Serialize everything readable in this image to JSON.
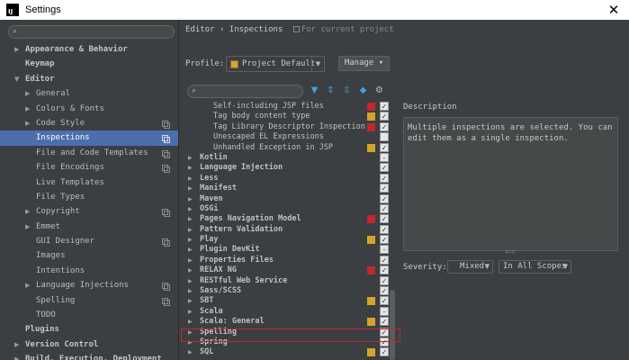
{
  "window": {
    "title": "Settings",
    "app_icon_text": "IJ",
    "close_glyph": "✕"
  },
  "sidebar": {
    "search_placeholder": "",
    "items": [
      {
        "label": "Appearance & Behavior",
        "level": 0,
        "arrow": "▶",
        "bold": true
      },
      {
        "label": "Keymap",
        "level": 0,
        "arrow": "",
        "bold": true
      },
      {
        "label": "Editor",
        "level": 0,
        "arrow": "▼",
        "bold": true
      },
      {
        "label": "General",
        "level": 1,
        "arrow": "▶"
      },
      {
        "label": "Colors & Fonts",
        "level": 1,
        "arrow": "▶"
      },
      {
        "label": "Code Style",
        "level": 1,
        "arrow": "▶",
        "copy": true
      },
      {
        "label": "Inspections",
        "level": 1,
        "arrow": "",
        "copy": true,
        "selected": true
      },
      {
        "label": "File and Code Templates",
        "level": 1,
        "arrow": "",
        "copy": true
      },
      {
        "label": "File Encodings",
        "level": 1,
        "arrow": "",
        "copy": true
      },
      {
        "label": "Live Templates",
        "level": 1,
        "arrow": ""
      },
      {
        "label": "File Types",
        "level": 1,
        "arrow": ""
      },
      {
        "label": "Copyright",
        "level": 1,
        "arrow": "▶",
        "copy": true
      },
      {
        "label": "Emmet",
        "level": 1,
        "arrow": "▶"
      },
      {
        "label": "GUI Designer",
        "level": 1,
        "arrow": "",
        "copy": true
      },
      {
        "label": "Images",
        "level": 1,
        "arrow": ""
      },
      {
        "label": "Intentions",
        "level": 1,
        "arrow": ""
      },
      {
        "label": "Language Injections",
        "level": 1,
        "arrow": "▶",
        "copy": true
      },
      {
        "label": "Spelling",
        "level": 1,
        "arrow": "",
        "copy": true
      },
      {
        "label": "TODO",
        "level": 1,
        "arrow": ""
      },
      {
        "label": "Plugins",
        "level": 0,
        "arrow": "",
        "bold": true
      },
      {
        "label": "Version Control",
        "level": 0,
        "arrow": "▶",
        "bold": true
      },
      {
        "label": "Build, Execution, Deployment",
        "level": 0,
        "arrow": "▶",
        "bold": true
      }
    ]
  },
  "header": {
    "breadcrumb_editor": "Editor",
    "breadcrumb_sep": "›",
    "breadcrumb_page": "Inspections",
    "scope_note": "For current project"
  },
  "profile": {
    "label": "Profile:",
    "value": "Project Default",
    "dropdown_glyph": "▼",
    "manage_label": "Manage ▾"
  },
  "toolbar": {
    "search_glyph": "⌕",
    "filter_glyph": "▼",
    "expand_glyph": "⇕",
    "collapse_glyph": "⇳",
    "reset_glyph": "◆",
    "settings_glyph": "⚙"
  },
  "colors": {
    "error": "#c2272d",
    "warning": "#d6a22a",
    "weak_warning": "#6e6e6e",
    "selection": "#4b6eaf"
  },
  "inspections": [
    {
      "label": "Self-including JSP files",
      "child": true,
      "severity": "error",
      "check": "✓"
    },
    {
      "label": "Tag body content type",
      "child": true,
      "severity": "warning",
      "check": "✓"
    },
    {
      "label": "Tag Library Descriptor Inspection",
      "child": true,
      "severity": "error",
      "check": "✓"
    },
    {
      "label": "Unescaped EL Expressions",
      "child": true,
      "severity": "none",
      "check": ""
    },
    {
      "label": "Unhandled Exception in JSP",
      "child": true,
      "severity": "warning",
      "check": "✓"
    },
    {
      "label": "Kotlin",
      "severity": "none",
      "check": "–"
    },
    {
      "label": "Language Injection",
      "severity": "none",
      "check": "✓"
    },
    {
      "label": "Less",
      "severity": "none",
      "check": "✓"
    },
    {
      "label": "Manifest",
      "severity": "none",
      "check": "✓"
    },
    {
      "label": "Maven",
      "severity": "none",
      "check": "✓"
    },
    {
      "label": "OSGi",
      "severity": "none",
      "check": "✓"
    },
    {
      "label": "Pages Navigation Model",
      "severity": "error",
      "check": "✓"
    },
    {
      "label": "Pattern Validation",
      "severity": "none",
      "check": "✓"
    },
    {
      "label": "Play",
      "severity": "warning",
      "check": "✓"
    },
    {
      "label": "Plugin DevKit",
      "severity": "none",
      "check": "–"
    },
    {
      "label": "Properties Files",
      "severity": "none",
      "check": "✓"
    },
    {
      "label": "RELAX NG",
      "severity": "error",
      "check": "✓"
    },
    {
      "label": "RESTful Web Service",
      "severity": "none",
      "check": "✓"
    },
    {
      "label": "Sass/SCSS",
      "severity": "none",
      "check": "✓"
    },
    {
      "label": "SBT",
      "severity": "warning",
      "check": "✓"
    },
    {
      "label": "Scala",
      "severity": "none",
      "check": "–"
    },
    {
      "label": "Scala: General",
      "severity": "warning",
      "check": "✓"
    },
    {
      "label": "Spelling",
      "severity": "none",
      "check": "✓",
      "highlighted": true
    },
    {
      "label": "Spring",
      "severity": "none",
      "check": "✓"
    },
    {
      "label": "SQL",
      "severity": "warning",
      "check": "✓"
    }
  ],
  "description": {
    "label": "Description",
    "text": "Multiple inspections are selected. You can edit them as a single inspection."
  },
  "severity": {
    "label": "Severity:",
    "value": "Mixed",
    "scope_value": "In All Scopes",
    "dropdown_glyph": "▼"
  }
}
